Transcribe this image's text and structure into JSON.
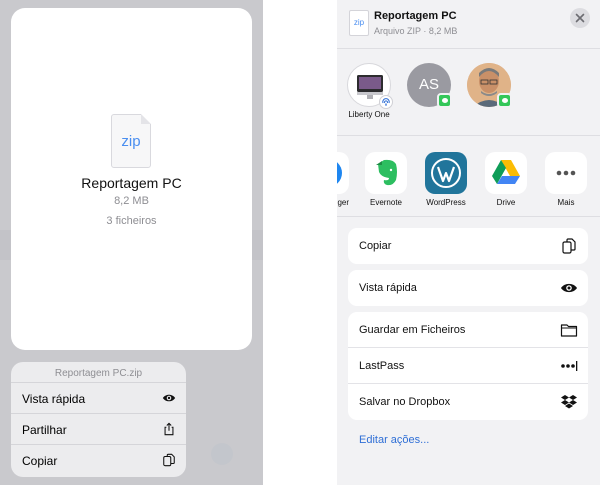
{
  "left": {
    "preview": {
      "icon_text": "zip",
      "title": "Reportagem PC",
      "size": "8,2 MB",
      "files": "3 ficheiros"
    },
    "context_menu": {
      "header": "Reportagem PC.zip",
      "items": [
        {
          "label": "Vista rápida",
          "icon": "eye-icon"
        },
        {
          "label": "Partilhar",
          "icon": "share-icon"
        },
        {
          "label": "Copiar",
          "icon": "copy-icon"
        }
      ]
    }
  },
  "right": {
    "header": {
      "icon_text": "zip",
      "title": "Reportagem PC",
      "subtitle": "Arquivo ZIP · 8,2 MB"
    },
    "people": [
      {
        "label": "Liberty One",
        "avatar": "imac-avatar",
        "badge": "airdrop-icon"
      },
      {
        "initials": "AS",
        "avatar": "initials-avatar",
        "badge": "messages-icon"
      },
      {
        "avatar": "photo-avatar",
        "badge": "messages-icon"
      }
    ],
    "apps": [
      {
        "label": "ger",
        "icon": "messenger-icon"
      },
      {
        "label": "Evernote",
        "icon": "evernote-icon"
      },
      {
        "label": "WordPress",
        "icon": "wordpress-icon"
      },
      {
        "label": "Drive",
        "icon": "drive-icon"
      },
      {
        "label": "Mais",
        "icon": "more-icon"
      }
    ],
    "actions_group1": [
      {
        "label": "Copiar",
        "icon": "copy-icon"
      }
    ],
    "actions_group2": [
      {
        "label": "Vista rápida",
        "icon": "eye-icon"
      }
    ],
    "actions_group3": [
      {
        "label": "Guardar em Ficheiros",
        "icon": "folder-icon"
      },
      {
        "label": "LastPass",
        "icon": "lastpass-icon"
      },
      {
        "label": "Salvar no Dropbox",
        "icon": "dropbox-icon"
      }
    ],
    "edit_actions": "Editar ações..."
  },
  "colors": {
    "accent": "#2f6fd6",
    "messages_green": "#34c759",
    "wordpress_blue": "#21759b",
    "evernote_green": "#2dbe60"
  }
}
